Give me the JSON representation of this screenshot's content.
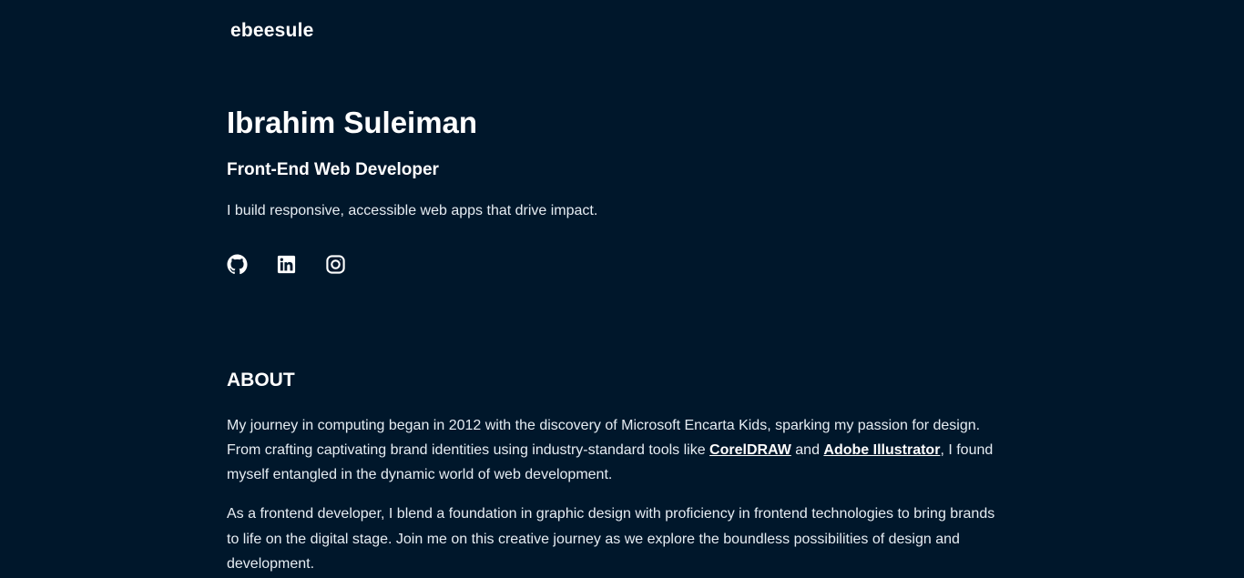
{
  "header": {
    "logo": "ebeesule"
  },
  "hero": {
    "name": "Ibrahim Suleiman",
    "role": "Front-End Web Developer",
    "tagline": "I build responsive, accessible web apps that drive impact."
  },
  "socials": [
    {
      "icon": "github-icon"
    },
    {
      "icon": "linkedin-icon"
    },
    {
      "icon": "instagram-icon"
    }
  ],
  "about": {
    "heading": "ABOUT",
    "p1_before": "My journey in computing began in 2012 with the discovery of Microsoft Encarta Kids, sparking my passion for design. From crafting captivating brand identities using industry-standard tools like ",
    "link_coreldraw": "CorelDRAW",
    "p1_and": " and ",
    "link_illustrator": "Adobe Illustrator",
    "p1_after": ", I found myself entangled in the dynamic world of web development.",
    "p2": "As a frontend developer, I blend a foundation in graphic design with proficiency in frontend technologies to bring brands to life on the digital stage. Join me on this creative journey as we explore the boundless possibilities of design and development."
  },
  "colors": {
    "background": "#00172b",
    "text": "#e6edf3",
    "heading": "#ffffff"
  }
}
